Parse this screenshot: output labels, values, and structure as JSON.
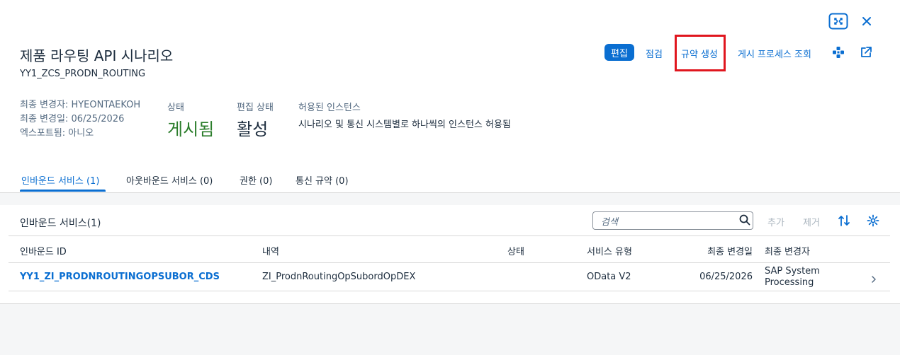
{
  "header": {
    "title": "제품 라우팅 API 시나리오",
    "subtitle": "YY1_ZCS_PRODN_ROUTING",
    "actions": {
      "edit": "편집",
      "check": "점검",
      "generate_rule": "규약 생성",
      "view_publish_process": "게시 프로세스 조회"
    },
    "meta": {
      "last_changed_by": "최종 변경자: HYEONTAEKOH",
      "last_changed_on": "최종 변경일: 06/25/2026",
      "exported": "엑스포트됨: 아니오"
    },
    "status_label": "상태",
    "status_value": "게시됨",
    "edit_status_label": "편집 상태",
    "edit_status_value": "활성",
    "allowed_instances_label": "허용된 인스턴스",
    "allowed_instances_value": "시나리오 및 통신 시스템별로 하나씩의 인스턴스 허용됨"
  },
  "colors": {
    "accent": "#0a6ed1",
    "status_green": "#2b7d2b",
    "highlight_red": "#e0161e"
  },
  "tabs": [
    {
      "label": "인바운드 서비스 (1)"
    },
    {
      "label": "아웃바운드 서비스 (0)"
    },
    {
      "label": "권한 (0)"
    },
    {
      "label": "통신 규약 (0)"
    }
  ],
  "panel": {
    "title": "인바운드 서비스(1)",
    "search_placeholder": "검색",
    "add": "추가",
    "remove": "제거"
  },
  "table": {
    "columns": [
      "인바운드 ID",
      "내역",
      "상태",
      "서비스 유형",
      "최종 변경일",
      "최종 변경자"
    ],
    "rows": [
      {
        "id": "YY1_ZI_PRODNROUTINGOPSUBOR_CDS",
        "desc": "ZI_ProdnRoutingOpSubordOpDEX",
        "status": "",
        "service_type": "OData V2",
        "changed_on": "06/25/2026",
        "changed_by_1": "SAP System",
        "changed_by_2": "Processing"
      }
    ]
  }
}
